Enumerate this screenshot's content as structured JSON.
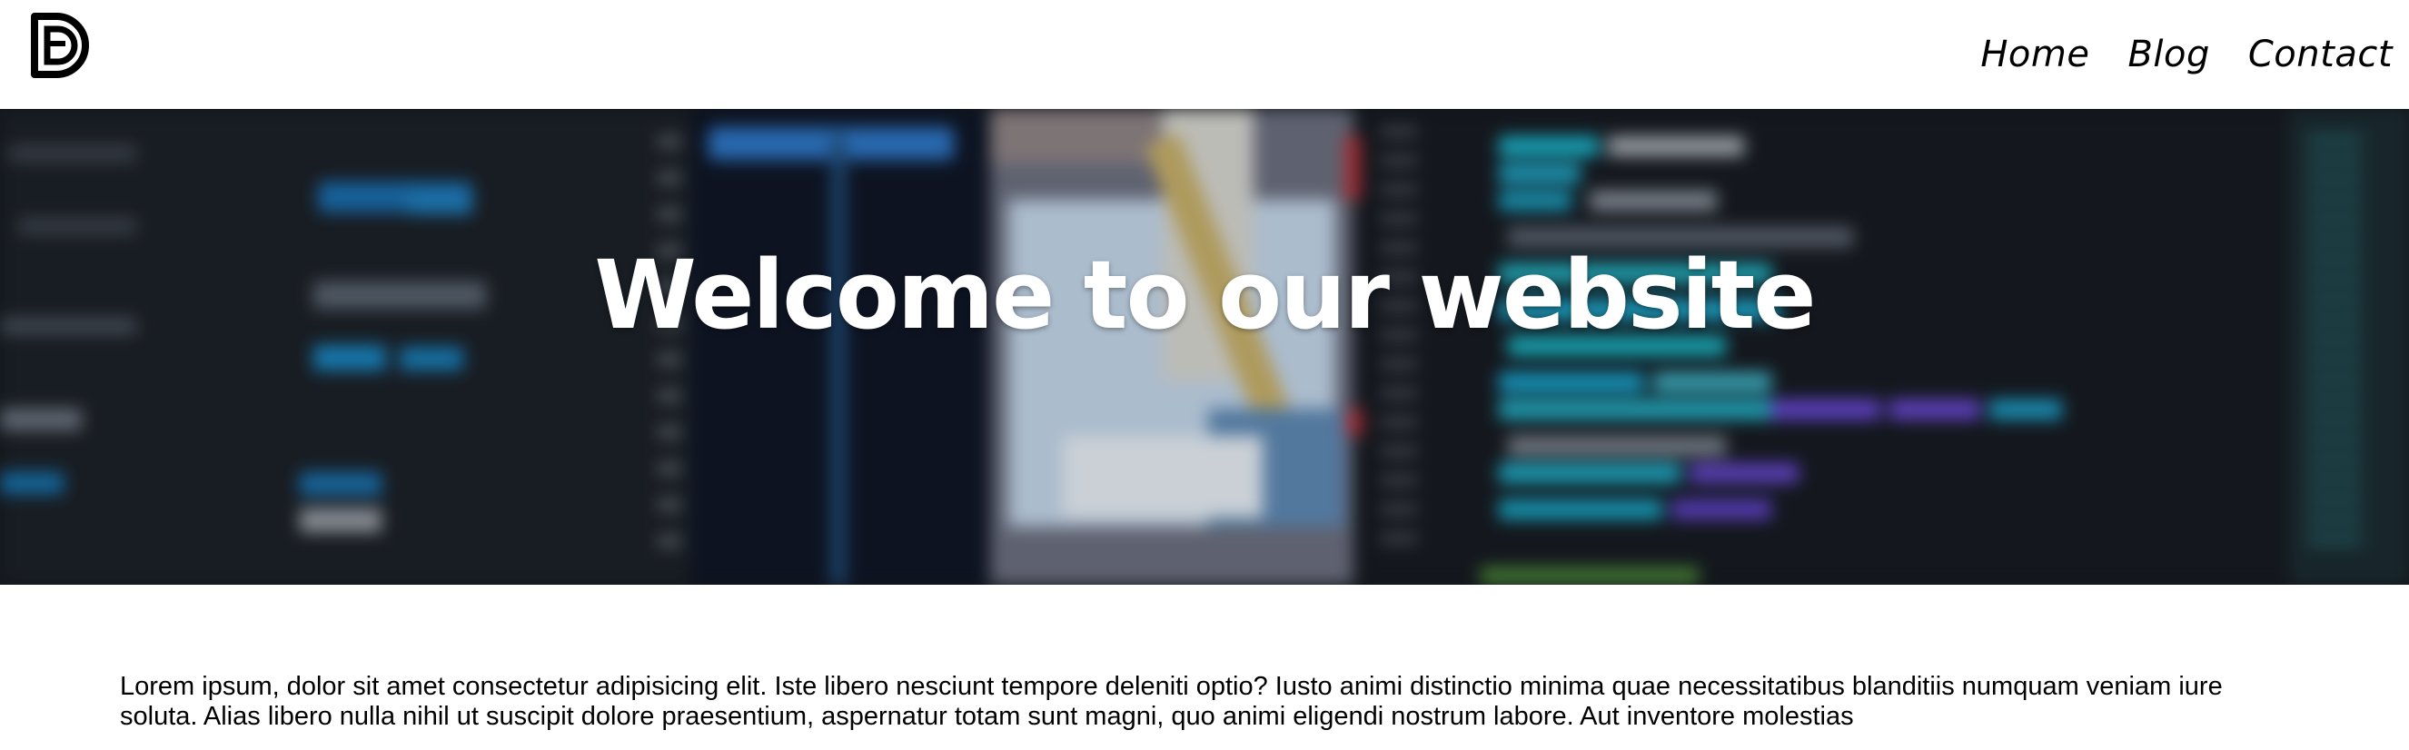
{
  "header": {
    "logo_icon": "db-monogram-logo",
    "nav": [
      {
        "label": "Home"
      },
      {
        "label": "Blog"
      },
      {
        "label": "Contact"
      }
    ]
  },
  "hero": {
    "title": "Welcome to our website",
    "background": "blurred-code-editor-photo"
  },
  "main": {
    "paragraph": "Lorem ipsum, dolor sit amet consectetur adipisicing elit. Iste libero nesciunt tempore deleniti optio? Iusto animi distinctio minima quae necessitatibus blanditiis numquam veniam iure soluta. Alias libero nulla nihil ut suscipit dolore praesentium, aspernatur totam sunt magni, quo animi eligendi nostrum labore. Aut inventore molestias"
  },
  "colors": {
    "header_bg": "#ffffff",
    "hero_bg": "#161a20",
    "hero_title": "#ffffff",
    "text": "#000000"
  }
}
